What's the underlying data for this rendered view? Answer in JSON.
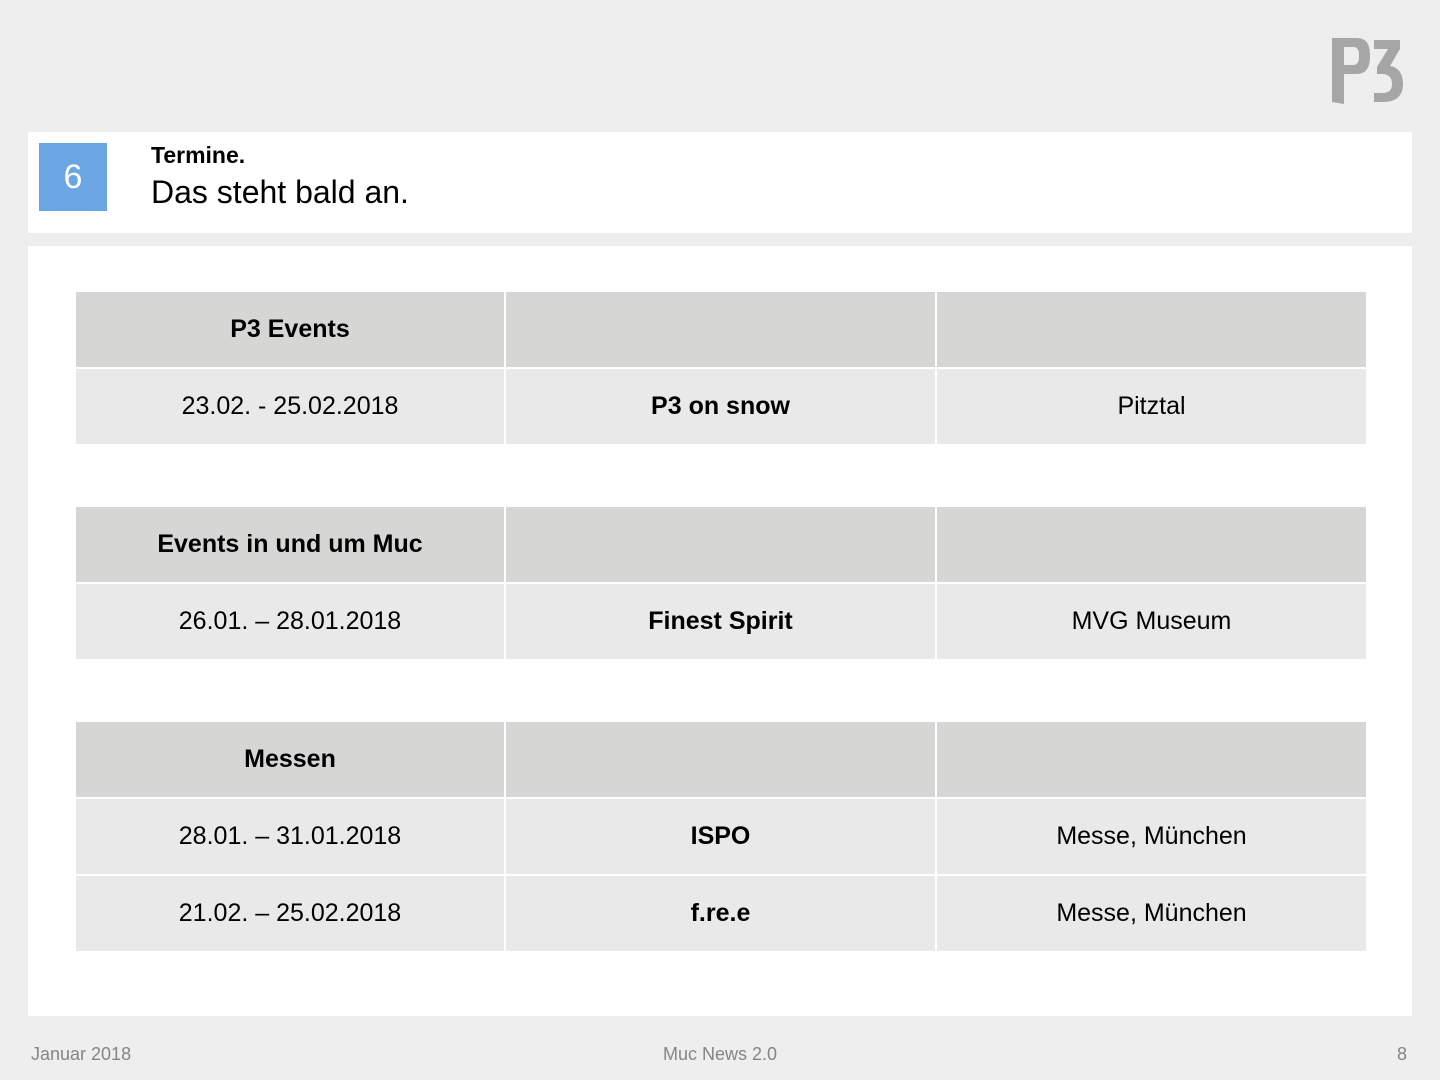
{
  "brand": {
    "logo_text": "P3",
    "logo_color": "#a6a6a6"
  },
  "header": {
    "chapter_number": "6",
    "chapter_color": "#6aa5e4",
    "kicker": "Termine.",
    "headline": "Das steht bald an."
  },
  "tables": [
    {
      "category": "P3 Events",
      "rows": [
        {
          "date": "23.02. - 25.02.2018",
          "name": "P3 on snow",
          "location": "Pitztal"
        }
      ]
    },
    {
      "category": "Events in und um Muc",
      "rows": [
        {
          "date": "26.01. – 28.01.2018",
          "name": "Finest Spirit",
          "location": "MVG Museum"
        }
      ]
    },
    {
      "category": "Messen",
      "rows": [
        {
          "date": "28.01. – 31.01.2018",
          "name": "ISPO",
          "location": "Messe, München"
        },
        {
          "date": "21.02. – 25.02.2018",
          "name": "f.re.e",
          "location": "Messe, München"
        }
      ]
    }
  ],
  "footer": {
    "date": "Januar 2018",
    "title": "Muc News 2.0",
    "page": "8"
  }
}
